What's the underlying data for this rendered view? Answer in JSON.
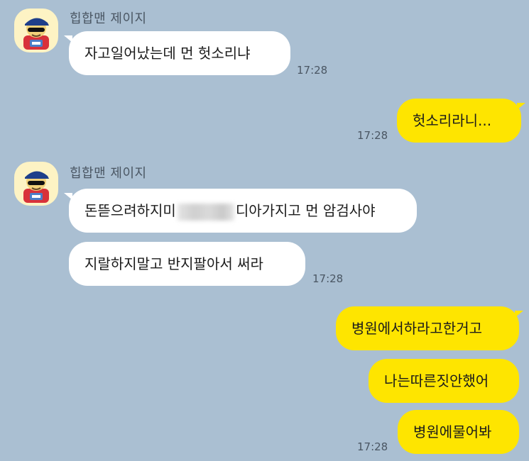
{
  "chat": {
    "group1": {
      "sender": "힙합맨 제이지",
      "messages": [
        {
          "text": "자고일어났는데 먼 헛소리냐",
          "time": "17:28"
        }
      ]
    },
    "reply1": {
      "text": "헛소리라니...",
      "time": "17:28"
    },
    "group2": {
      "sender": "힙합맨 제이지",
      "msg1_before": "돈뜯으려하지미",
      "msg1_after": "디아가지고 먼 암검사야",
      "msg2": "지랄하지말고 반지팔아서 써라",
      "time": "17:28"
    },
    "replies2": [
      {
        "text": "병원에서하라고한거고"
      },
      {
        "text": "나는따른짓안했어"
      },
      {
        "text": "병원에물어봐"
      }
    ],
    "replies2_time": "17:28"
  },
  "colors": {
    "background": "#aabfd2",
    "incoming_bubble": "#ffffff",
    "outgoing_bubble": "#fee500"
  },
  "icons": {
    "avatar": "hiphop-character-avatar"
  }
}
